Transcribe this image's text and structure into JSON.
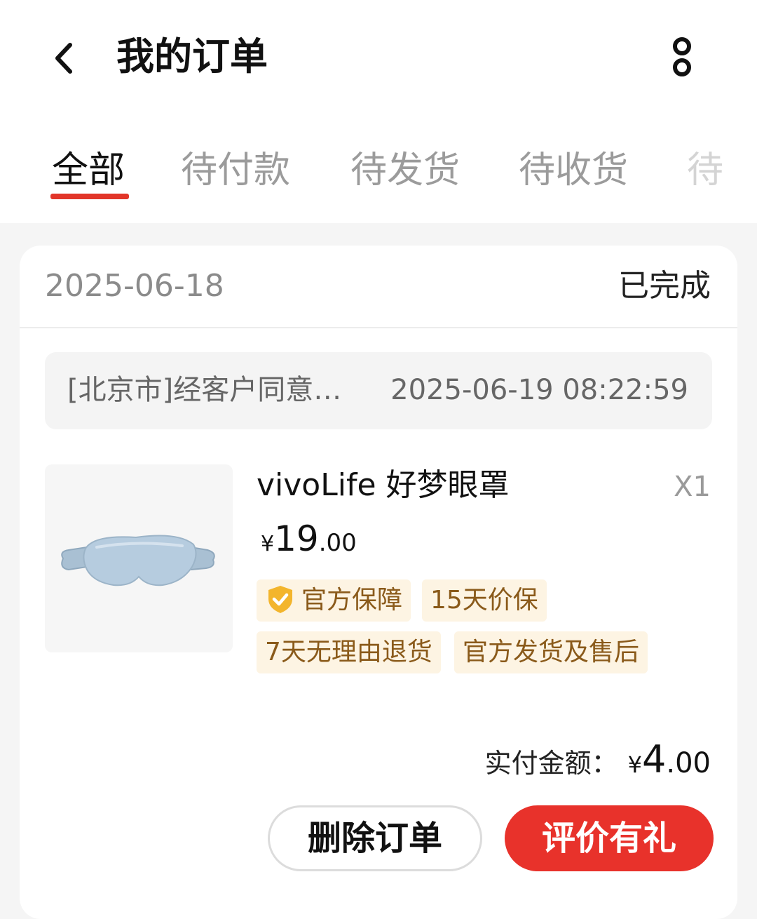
{
  "header": {
    "title": "我的订单"
  },
  "tabs": [
    {
      "label": "全部",
      "active": true
    },
    {
      "label": "待付款",
      "active": false
    },
    {
      "label": "待发货",
      "active": false
    },
    {
      "label": "待收货",
      "active": false
    },
    {
      "label": "待",
      "active": false
    }
  ],
  "order": {
    "date": "2025-06-18",
    "status": "已完成",
    "logistics": {
      "text": "[北京市]经客户同意…",
      "time": "2025-06-19 08:22:59"
    },
    "product": {
      "name": "vivoLife 好梦眼罩",
      "quantity": "X1",
      "price_currency": "¥",
      "price_integer": "19",
      "price_decimal": ".00",
      "tags": [
        "官方保障",
        "15天价保",
        "7天无理由退货",
        "官方发货及售后"
      ]
    },
    "paid_label": "实付金额：",
    "paid_currency": "¥",
    "paid_integer": "4",
    "paid_decimal": ".00",
    "actions": {
      "delete_label": "删除订单",
      "review_label": "评价有礼"
    }
  },
  "colors": {
    "accent": "#e23529",
    "review_button": "#e8322b",
    "tag_background": "#fdf4e3",
    "tag_text": "#8a5a1a"
  }
}
